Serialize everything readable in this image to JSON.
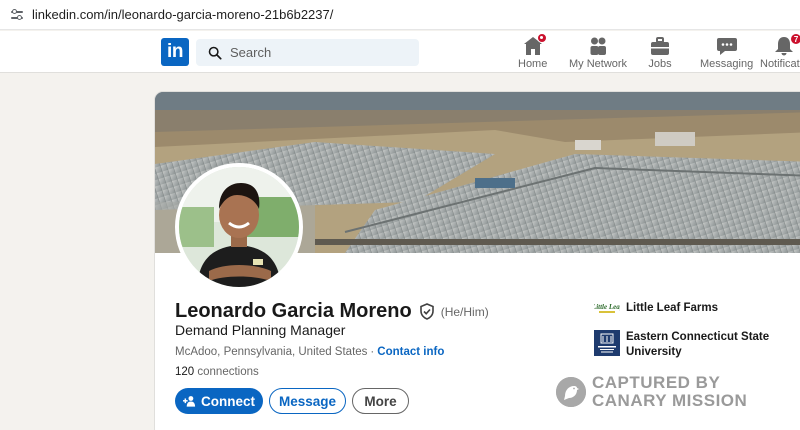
{
  "browser": {
    "url": "linkedin.com/in/leonardo-garcia-moreno-21b6b2237/"
  },
  "nav": {
    "logo_text": "in",
    "search_placeholder": "Search",
    "items": [
      {
        "label": "Home",
        "icon": "home-icon",
        "badge": ""
      },
      {
        "label": "My Network",
        "icon": "people-icon",
        "badge": ""
      },
      {
        "label": "Jobs",
        "icon": "briefcase-icon",
        "badge": ""
      },
      {
        "label": "Messaging",
        "icon": "chat-bubble-icon",
        "badge": ""
      },
      {
        "label": "Notificatio",
        "icon": "bell-icon",
        "badge": "7"
      }
    ]
  },
  "profile": {
    "name": "Leonardo Garcia Moreno",
    "pronouns": "(He/Him)",
    "headline": "Demand Planning Manager",
    "location": "McAdoo, Pennsylvania, United States",
    "separator": "·",
    "contact_info": "Contact info",
    "connections_count": "120",
    "connections_label": "connections",
    "buttons": {
      "connect": "Connect",
      "message": "Message",
      "more": "More"
    },
    "organizations": [
      {
        "name": "Little Leaf Farms",
        "logo_text": "Little Leaf"
      },
      {
        "name": "Eastern Connecticut State University"
      }
    ]
  },
  "watermark": {
    "line1": "CAPTURED BY",
    "line2": "CANARY MISSION"
  },
  "colors": {
    "brand": "#0a66c2",
    "notification_badge": "#cb112d",
    "page_background": "#f4f2ee"
  }
}
